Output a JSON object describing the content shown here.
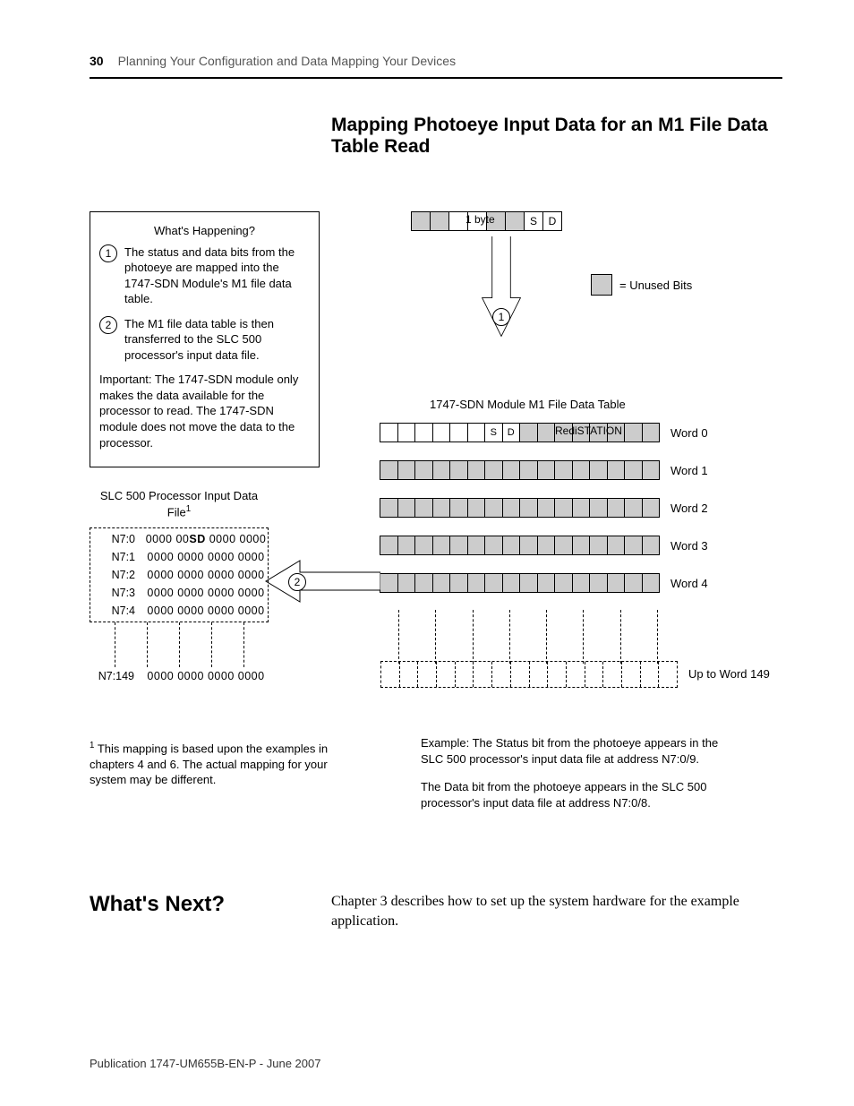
{
  "header": {
    "page_number": "30",
    "chapter": "Planning Your Configuration and Data Mapping Your Devices"
  },
  "section_title": "Mapping Photoeye Input Data for an M1 File Data Table Read",
  "whats_happening": {
    "title": "What's Happening?",
    "item1": "The status and data bits from the photoeye are mapped into the 1747-SDN Module's M1 file data table.",
    "item2": "The M1 file data table is then transferred to the SLC 500 processor's input data file.",
    "note": "Important: The 1747-SDN module only makes the data available for the processor to read. The 1747-SDN module does not move the data to the processor."
  },
  "byte_row": {
    "label": "1 byte",
    "s": "S",
    "d": "D",
    "legend": "= Unused Bits"
  },
  "m1": {
    "title": "1747-SDN Module M1 File Data Table",
    "s": "S",
    "d": "D",
    "redi": "RediSTATION",
    "word0": "Word 0",
    "word1": "Word 1",
    "word2": "Word 2",
    "word3": "Word 3",
    "word4": "Word 4",
    "wordLast": "Up to Word 149"
  },
  "slc": {
    "title": "SLC 500 Processor Input Data File",
    "sup": "1",
    "rows": {
      "r0l": "N7:0",
      "r0d": "0000 00SD 0000 0000",
      "r1l": "N7:1",
      "r1d": "0000 0000 0000 0000",
      "r2l": "N7:2",
      "r2d": "0000 0000 0000 0000",
      "r3l": "N7:3",
      "r3d": "0000 0000 0000 0000",
      "r4l": "N7:4",
      "r4d": "0000 0000 0000 0000",
      "rEl": "N7:149",
      "rEd": "0000 0000 0000 0000"
    }
  },
  "circle": {
    "one": "1",
    "two": "2"
  },
  "footnote": {
    "sup": "1",
    "text": " This mapping is based upon the examples in chapters 4 and 6. The actual mapping for your system may be different."
  },
  "examples": {
    "p1": "Example: The Status bit from the photoeye appears in the SLC 500 processor's input data file at address N7:0/9.",
    "p2": "The Data bit from the photoeye appears in the SLC 500 processor's input data file at address N7:0/8."
  },
  "whats_next": {
    "title": "What's Next?",
    "body": "Chapter 3 describes how to set up the system hardware for the example application."
  },
  "publication": "Publication 1747-UM655B-EN-P - June 2007"
}
